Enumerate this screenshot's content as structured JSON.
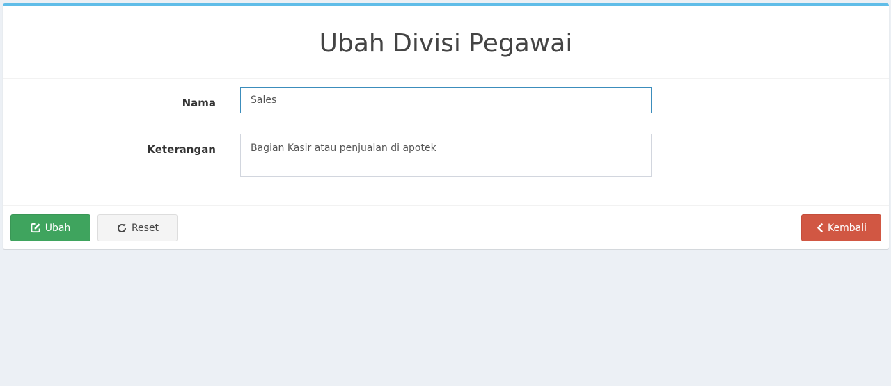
{
  "header": {
    "title": "Ubah Divisi Pegawai"
  },
  "form": {
    "nama": {
      "label": "Nama",
      "value": "Sales"
    },
    "keterangan": {
      "label": "Keterangan",
      "value": "Bagian Kasir atau penjualan di apotek"
    }
  },
  "footer": {
    "ubah_label": "Ubah",
    "reset_label": "Reset",
    "kembali_label": "Kembali"
  },
  "icons": {
    "ubah": "edit-square-icon",
    "reset": "refresh-icon",
    "kembali": "chevron-left-icon"
  },
  "colors": {
    "accent_top_border": "#60bde8",
    "success": "#3fa45e",
    "danger": "#d15743",
    "focus_border": "#3c8dbc",
    "page_background": "#ecf0f5"
  }
}
